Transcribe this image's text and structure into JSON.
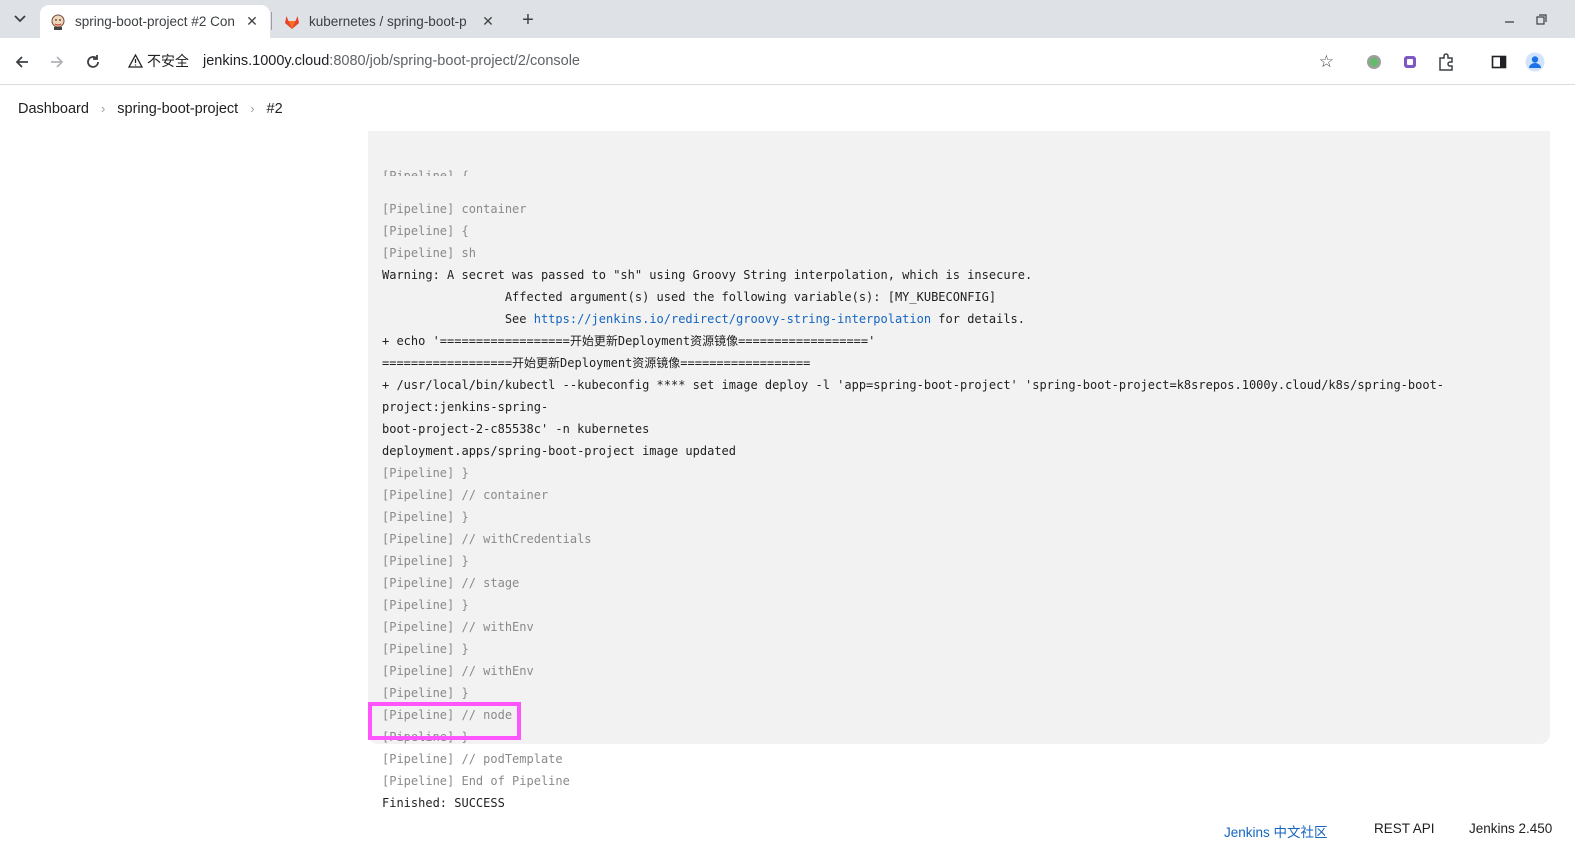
{
  "browser": {
    "tabs": [
      {
        "title": "spring-boot-project #2 Con",
        "active": true,
        "favicon": "jenkins-icon"
      },
      {
        "title": "kubernetes / spring-boot-p",
        "active": false,
        "favicon": "gitlab-icon"
      }
    ],
    "new_tab_label": "+",
    "security_label": "不安全",
    "url_host": "jenkins.1000y.cloud",
    "url_rest": ":8080/job/spring-boot-project/2/console"
  },
  "breadcrumb": {
    "items": [
      "Dashboard",
      "spring-boot-project",
      "#2"
    ],
    "separator": "›"
  },
  "console": {
    "partial_top": "[Pipeline] {",
    "lines": [
      {
        "text": "[Pipeline] container",
        "type": "pipeline"
      },
      {
        "text": "[Pipeline] {",
        "type": "pipeline"
      },
      {
        "text": "[Pipeline] sh",
        "type": "pipeline"
      },
      {
        "text": "Warning: A secret was passed to \"sh\" using Groovy String interpolation, which is insecure.",
        "type": "output"
      },
      {
        "text": "\t\t Affected argument(s) used the following variable(s): [MY_KUBECONFIG]",
        "type": "output"
      },
      {
        "text": "\t\t See ",
        "link": "https://jenkins.io/redirect/groovy-string-interpolation",
        "after": " for details.",
        "type": "output"
      },
      {
        "text": "+ echo '==================开始更新Deployment资源镜像=================='",
        "type": "output"
      },
      {
        "text": "==================开始更新Deployment资源镜像==================",
        "type": "output"
      },
      {
        "text": "+ /usr/local/bin/kubectl --kubeconfig **** set image deploy -l 'app=spring-boot-project' 'spring-boot-project=k8srepos.1000y.cloud/k8s/spring-boot-project:jenkins-spring-",
        "type": "output"
      },
      {
        "text": "boot-project-2-c85538c' -n kubernetes",
        "type": "output"
      },
      {
        "text": "deployment.apps/spring-boot-project image updated",
        "type": "output"
      },
      {
        "text": "[Pipeline] }",
        "type": "pipeline"
      },
      {
        "text": "[Pipeline] // container",
        "type": "pipeline"
      },
      {
        "text": "[Pipeline] }",
        "type": "pipeline"
      },
      {
        "text": "[Pipeline] // withCredentials",
        "type": "pipeline"
      },
      {
        "text": "[Pipeline] }",
        "type": "pipeline"
      },
      {
        "text": "[Pipeline] // stage",
        "type": "pipeline"
      },
      {
        "text": "[Pipeline] }",
        "type": "pipeline"
      },
      {
        "text": "[Pipeline] // withEnv",
        "type": "pipeline"
      },
      {
        "text": "[Pipeline] }",
        "type": "pipeline"
      },
      {
        "text": "[Pipeline] // withEnv",
        "type": "pipeline"
      },
      {
        "text": "[Pipeline] }",
        "type": "pipeline"
      },
      {
        "text": "[Pipeline] // node",
        "type": "pipeline"
      },
      {
        "text": "[Pipeline] }",
        "type": "pipeline"
      },
      {
        "text": "[Pipeline] // podTemplate",
        "type": "pipeline"
      },
      {
        "text": "[Pipeline] End of Pipeline",
        "type": "pipeline"
      },
      {
        "text": "Finished: SUCCESS",
        "type": "output"
      }
    ]
  },
  "highlight_color": "#ff55ff",
  "footer": {
    "community_link": "Jenkins 中文社区",
    "rest_api": "REST API",
    "version": "Jenkins 2.450"
  }
}
